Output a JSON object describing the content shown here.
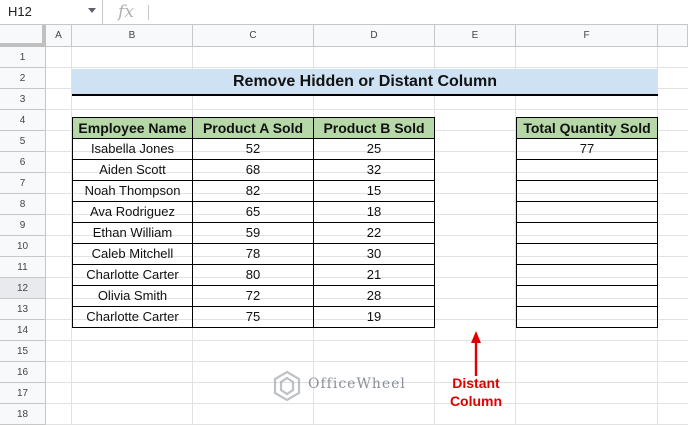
{
  "name_box": "H12",
  "formula_icon": "fx",
  "formula_value": "",
  "columns": [
    "A",
    "B",
    "C",
    "D",
    "E",
    "F"
  ],
  "rows": [
    "1",
    "2",
    "3",
    "4",
    "5",
    "6",
    "7",
    "8",
    "9",
    "10",
    "11",
    "12",
    "13",
    "14",
    "15",
    "16",
    "17",
    "18"
  ],
  "selected_row": "12",
  "title": "Remove Hidden or Distant Column",
  "table": {
    "headers": [
      "Employee Name",
      "Product A Sold",
      "Product B Sold"
    ],
    "rows": [
      [
        "Isabella Jones",
        "52",
        "25"
      ],
      [
        "Aiden Scott",
        "68",
        "32"
      ],
      [
        "Noah Thompson",
        "82",
        "15"
      ],
      [
        "Ava Rodriguez",
        "65",
        "18"
      ],
      [
        "Ethan William",
        "59",
        "22"
      ],
      [
        "Caleb Mitchell",
        "78",
        "30"
      ],
      [
        "Charlotte Carter",
        "80",
        "21"
      ],
      [
        "Olivia Smith",
        "72",
        "28"
      ],
      [
        "Charlotte Carter",
        "75",
        "19"
      ]
    ]
  },
  "total": {
    "header": "Total Quantity Sold",
    "values": [
      "77",
      "",
      "",
      "",
      "",
      "",
      "",
      "",
      ""
    ]
  },
  "annotation": {
    "line1": "Distant",
    "line2": "Column"
  },
  "watermark": "OfficeWheel",
  "colors": {
    "header_green": "#b6d7a8",
    "title_blue": "#cfe2f3",
    "annotation_red": "#e00000"
  }
}
